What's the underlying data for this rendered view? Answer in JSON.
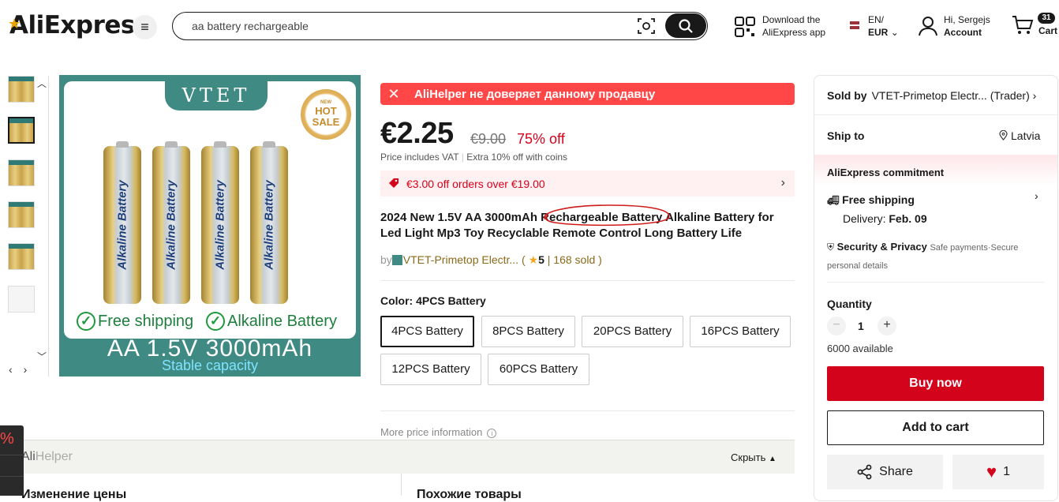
{
  "header": {
    "logo": "AliExpress",
    "search_value": "aa battery rechargeable",
    "download_line1": "Download the",
    "download_line2": "AliExpress app",
    "lang": "EN/",
    "currency": "EUR",
    "greeting": "Hi, Sergejs",
    "account": "Account",
    "cart_count": "31",
    "cart_label": "Cart"
  },
  "main_image": {
    "brand": "VTET",
    "hot_sale_small": "NEW",
    "hot_sale_line1": "HOT",
    "hot_sale_line2": "SALE",
    "battery_text": "Alkaline Battery",
    "feature1": "Free shipping",
    "feature2": "Alkaline Battery",
    "spec": "AA  1.5V  3000mAh",
    "stable": "Stable capacity"
  },
  "alihelper_warning": "AliHelper не доверяет данному продавцу",
  "price": {
    "current": "€2.25",
    "original": "€9.00",
    "discount": "75% off",
    "vat_note": "Price includes VAT",
    "coins_note": "Extra 10% off with coins"
  },
  "coupon": "€3.00 off orders over €19.00",
  "product_title": "2024 New 1.5V AA 3000mAh Rechargeable Battery Alkaline Battery for Led Light Mp3 Toy Recyclable Remote Control Long Battery Life",
  "store": {
    "by": "by",
    "name": "VTET-Primetop Electr...",
    "rating": "5",
    "sold": "168 sold"
  },
  "color": {
    "label": "Color:",
    "selected": "4PCS Battery",
    "options": [
      "4PCS Battery",
      "8PCS Battery",
      "20PCS Battery",
      "16PCS Battery",
      "12PCS Battery",
      "60PCS Battery"
    ]
  },
  "more_price": "More price information",
  "alihelper_panel": {
    "title_a": "Ali",
    "title_b": "Helper",
    "hide": "Скрыть",
    "hide_arrow": "▲",
    "col1": "Изменение цены",
    "col2": "Похожие товары",
    "side_pct": "%"
  },
  "right_panel": {
    "sold_by_label": "Sold by",
    "sold_by_value": "VTET-Primetop Electr... (Trader)",
    "ship_to_label": "Ship to",
    "ship_to_value": "Latvia",
    "commitment": "AliExpress commitment",
    "free_shipping": "Free shipping",
    "delivery_label": "Delivery:",
    "delivery_date": "Feb. 09",
    "security": "Security & Privacy",
    "security_sub": "Safe payments·Secure personal details",
    "quantity_label": "Quantity",
    "quantity": "1",
    "available": "6000 available",
    "buy_now": "Buy now",
    "add_to_cart": "Add to cart",
    "share": "Share",
    "wishlist_count": "1"
  },
  "colors": {
    "accent_red": "#d3031c",
    "helper_red": "#ff4747",
    "brand_teal": "#3f8a83"
  }
}
